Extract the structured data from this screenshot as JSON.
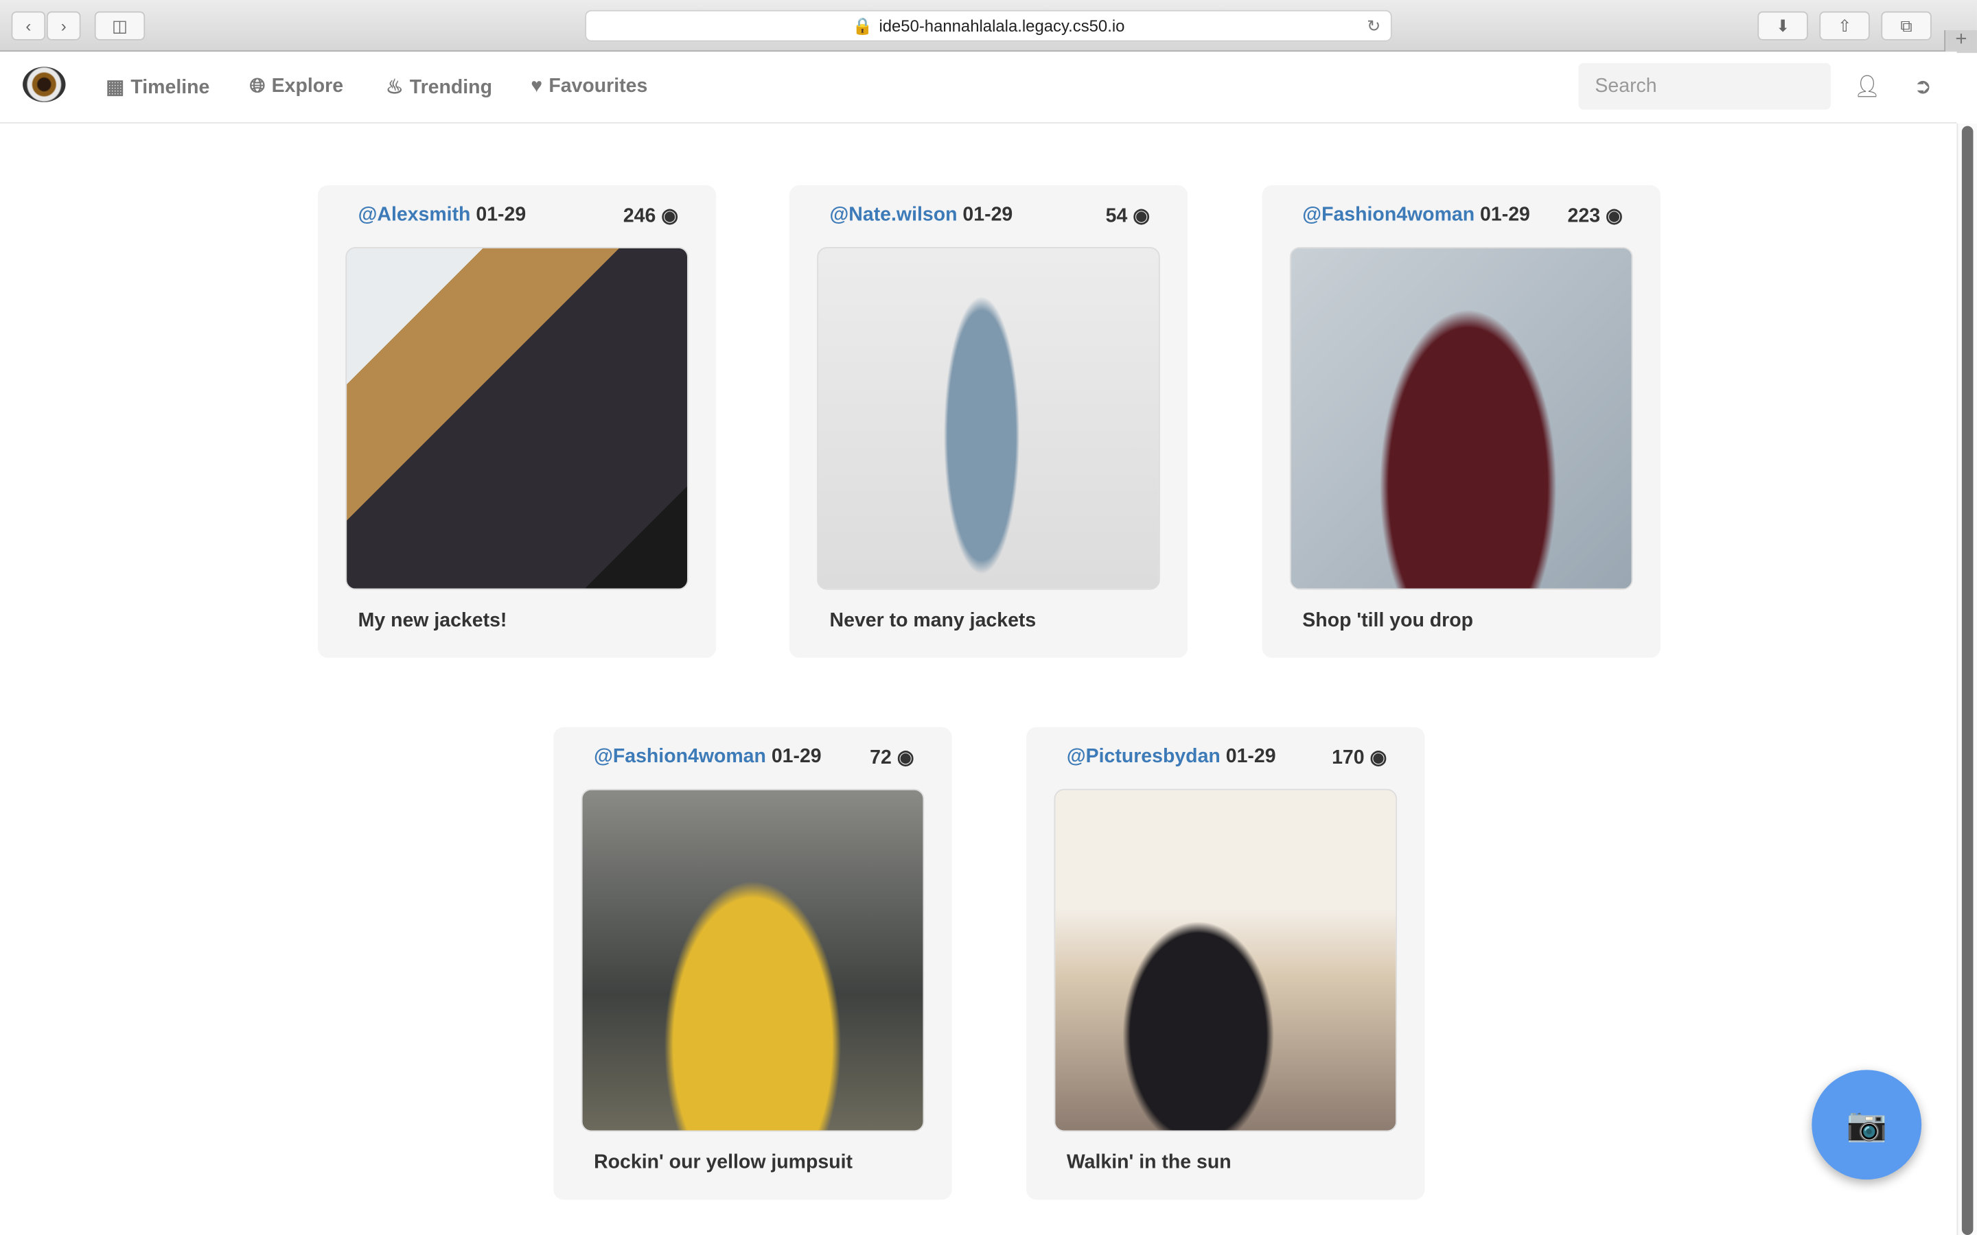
{
  "browser": {
    "url": "ide50-hannahlalala.legacy.cs50.io"
  },
  "nav": {
    "items": [
      {
        "label": "Timeline",
        "icon": "grid-icon"
      },
      {
        "label": "Explore",
        "icon": "globe-icon"
      },
      {
        "label": "Trending",
        "icon": "fire-icon"
      },
      {
        "label": "Favourites",
        "icon": "heart-icon"
      }
    ],
    "search_placeholder": "Search"
  },
  "posts": [
    {
      "user": "@Alexsmith",
      "date": "01-29",
      "views": "246",
      "caption": "My new jackets!"
    },
    {
      "user": "@Nate.wilson",
      "date": "01-29",
      "views": "54",
      "caption": "Never to many jackets"
    },
    {
      "user": "@Fashion4woman",
      "date": "01-29",
      "views": "223",
      "caption": "Shop 'till you drop"
    },
    {
      "user": "@Fashion4woman",
      "date": "01-29",
      "views": "72",
      "caption": "Rockin' our yellow jumpsuit"
    },
    {
      "user": "@Picturesbydan",
      "date": "01-29",
      "views": "170",
      "caption": "Walkin' in the sun"
    }
  ],
  "colors": {
    "accent": "#3d7ab8",
    "fab": "#5a9bf0"
  }
}
